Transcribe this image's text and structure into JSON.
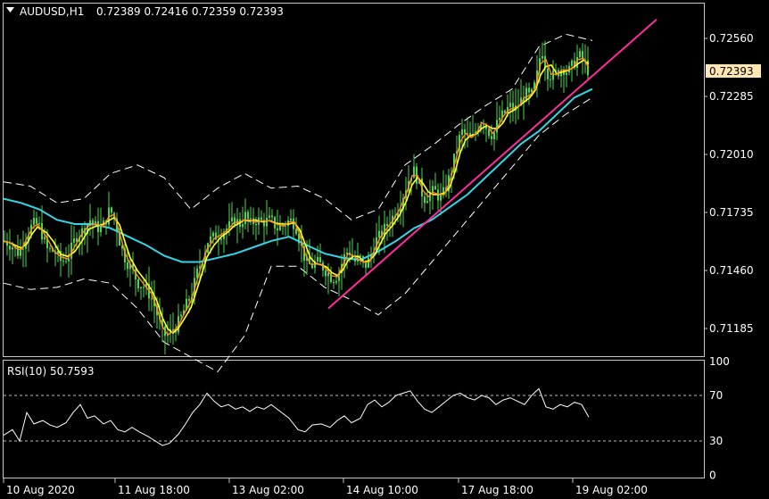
{
  "symbol_line": {
    "symbol": "AUDUSD,H1",
    "ohlc": "0.72389 0.72416 0.72359 0.72393"
  },
  "rsi_label": "RSI(10) 50.7593",
  "current_price": "0.72393",
  "colors": {
    "background": "#000000",
    "frame": "#c8c8c8",
    "candle": "#4cd64c",
    "ma_fast": "#ff8c1a",
    "ma_slow": "#ffff33",
    "ma_long": "#33d6e6",
    "bands": "#ffffff",
    "trendline": "#ff2d9b",
    "price_tag_bg": "#ffe6b3",
    "rsi_line": "#ffffff"
  },
  "chart_data": [
    {
      "type": "candlestick",
      "title": "AUDUSD,H1",
      "y_ticks": [
        0.7256,
        0.72285,
        0.7201,
        0.71735,
        0.7146,
        0.71185
      ],
      "y_tick_labels": [
        "0.72560",
        "0.72285",
        "0.72010",
        "0.71735",
        "0.71460",
        "0.71185"
      ],
      "ylim": [
        0.7099,
        0.7266
      ],
      "x_tick_labels": [
        "10 Aug 2020",
        "11 Aug 18:00",
        "13 Aug 02:00",
        "14 Aug 10:00",
        "17 Aug 18:00",
        "19 Aug 02:00"
      ],
      "close_path": [
        [
          0,
          0.716
        ],
        [
          8,
          0.7158
        ],
        [
          16,
          0.7154
        ],
        [
          20,
          0.7158
        ],
        [
          26,
          0.7164
        ],
        [
          32,
          0.7168
        ],
        [
          38,
          0.7168
        ],
        [
          48,
          0.7156
        ],
        [
          56,
          0.7155
        ],
        [
          64,
          0.715
        ],
        [
          72,
          0.7153
        ],
        [
          80,
          0.7162
        ],
        [
          88,
          0.7165
        ],
        [
          96,
          0.717
        ],
        [
          104,
          0.7166
        ],
        [
          112,
          0.7168
        ],
        [
          118,
          0.7175
        ],
        [
          124,
          0.717
        ],
        [
          130,
          0.7158
        ],
        [
          136,
          0.7151
        ],
        [
          142,
          0.7147
        ],
        [
          150,
          0.714
        ],
        [
          158,
          0.7138
        ],
        [
          166,
          0.7132
        ],
        [
          172,
          0.7124
        ],
        [
          178,
          0.7115
        ],
        [
          184,
          0.7116
        ],
        [
          190,
          0.7118
        ],
        [
          196,
          0.7122
        ],
        [
          202,
          0.7128
        ],
        [
          210,
          0.7135
        ],
        [
          216,
          0.7145
        ],
        [
          222,
          0.7152
        ],
        [
          228,
          0.716
        ],
        [
          236,
          0.7162
        ],
        [
          244,
          0.7164
        ],
        [
          252,
          0.7167
        ],
        [
          258,
          0.717
        ],
        [
          264,
          0.7168
        ],
        [
          270,
          0.7172
        ],
        [
          276,
          0.7168
        ],
        [
          282,
          0.717
        ],
        [
          290,
          0.7169
        ],
        [
          298,
          0.717
        ],
        [
          306,
          0.7166
        ],
        [
          314,
          0.7168
        ],
        [
          320,
          0.717
        ],
        [
          326,
          0.7168
        ],
        [
          332,
          0.7158
        ],
        [
          338,
          0.715
        ],
        [
          344,
          0.7148
        ],
        [
          350,
          0.715
        ],
        [
          356,
          0.7148
        ],
        [
          362,
          0.7145
        ],
        [
          368,
          0.7142
        ],
        [
          374,
          0.7144
        ],
        [
          380,
          0.7152
        ],
        [
          386,
          0.7156
        ],
        [
          392,
          0.715
        ],
        [
          398,
          0.7152
        ],
        [
          404,
          0.7148
        ],
        [
          410,
          0.7152
        ],
        [
          416,
          0.716
        ],
        [
          422,
          0.7163
        ],
        [
          428,
          0.7167
        ],
        [
          436,
          0.7172
        ],
        [
          444,
          0.7178
        ],
        [
          452,
          0.7188
        ],
        [
          458,
          0.7194
        ],
        [
          464,
          0.7188
        ],
        [
          470,
          0.718
        ],
        [
          476,
          0.7182
        ],
        [
          482,
          0.7184
        ],
        [
          488,
          0.718
        ],
        [
          494,
          0.7184
        ],
        [
          500,
          0.7192
        ],
        [
          506,
          0.7202
        ],
        [
          512,
          0.7212
        ],
        [
          518,
          0.721
        ],
        [
          524,
          0.7208
        ],
        [
          530,
          0.7214
        ],
        [
          536,
          0.7218
        ],
        [
          542,
          0.7212
        ],
        [
          548,
          0.721
        ],
        [
          554,
          0.7218
        ],
        [
          560,
          0.722
        ],
        [
          566,
          0.7224
        ],
        [
          572,
          0.7222
        ],
        [
          578,
          0.7226
        ],
        [
          584,
          0.723
        ],
        [
          590,
          0.7228
        ],
        [
          596,
          0.7236
        ],
        [
          602,
          0.7252
        ],
        [
          608,
          0.724
        ],
        [
          614,
          0.7238
        ],
        [
          620,
          0.724
        ],
        [
          626,
          0.7242
        ],
        [
          632,
          0.724
        ],
        [
          638,
          0.7244
        ],
        [
          644,
          0.7248
        ],
        [
          650,
          0.7245
        ],
        [
          656,
          0.7239
        ]
      ],
      "ma_long_path": [
        [
          0,
          0.718
        ],
        [
          20,
          0.7178
        ],
        [
          40,
          0.7175
        ],
        [
          60,
          0.717
        ],
        [
          80,
          0.7168
        ],
        [
          100,
          0.7168
        ],
        [
          120,
          0.7166
        ],
        [
          140,
          0.7162
        ],
        [
          160,
          0.7158
        ],
        [
          180,
          0.7153
        ],
        [
          200,
          0.715
        ],
        [
          220,
          0.715
        ],
        [
          240,
          0.7152
        ],
        [
          260,
          0.7154
        ],
        [
          280,
          0.7157
        ],
        [
          300,
          0.716
        ],
        [
          320,
          0.7162
        ],
        [
          340,
          0.7158
        ],
        [
          360,
          0.7154
        ],
        [
          380,
          0.7152
        ],
        [
          400,
          0.7151
        ],
        [
          420,
          0.7155
        ],
        [
          440,
          0.716
        ],
        [
          460,
          0.7166
        ],
        [
          480,
          0.717
        ],
        [
          500,
          0.7176
        ],
        [
          520,
          0.7182
        ],
        [
          540,
          0.719
        ],
        [
          560,
          0.7198
        ],
        [
          580,
          0.7206
        ],
        [
          600,
          0.7212
        ],
        [
          620,
          0.722
        ],
        [
          640,
          0.7228
        ],
        [
          660,
          0.7232
        ]
      ],
      "band_upper_path": [
        [
          0,
          0.7188
        ],
        [
          30,
          0.7186
        ],
        [
          60,
          0.7178
        ],
        [
          90,
          0.718
        ],
        [
          120,
          0.7192
        ],
        [
          150,
          0.7196
        ],
        [
          180,
          0.719
        ],
        [
          210,
          0.7175
        ],
        [
          240,
          0.7185
        ],
        [
          270,
          0.7192
        ],
        [
          300,
          0.7185
        ],
        [
          330,
          0.7186
        ],
        [
          360,
          0.718
        ],
        [
          390,
          0.717
        ],
        [
          420,
          0.7175
        ],
        [
          450,
          0.7196
        ],
        [
          480,
          0.7205
        ],
        [
          510,
          0.7215
        ],
        [
          540,
          0.7224
        ],
        [
          570,
          0.7232
        ],
        [
          600,
          0.7252
        ],
        [
          630,
          0.7258
        ],
        [
          660,
          0.7255
        ]
      ],
      "band_lower_path": [
        [
          0,
          0.714
        ],
        [
          30,
          0.7137
        ],
        [
          60,
          0.7138
        ],
        [
          90,
          0.7142
        ],
        [
          120,
          0.714
        ],
        [
          150,
          0.7128
        ],
        [
          180,
          0.7112
        ],
        [
          210,
          0.7105
        ],
        [
          240,
          0.7098
        ],
        [
          270,
          0.7115
        ],
        [
          300,
          0.7148
        ],
        [
          330,
          0.7148
        ],
        [
          360,
          0.7138
        ],
        [
          390,
          0.7132
        ],
        [
          420,
          0.7125
        ],
        [
          450,
          0.7135
        ],
        [
          480,
          0.715
        ],
        [
          510,
          0.7165
        ],
        [
          540,
          0.718
        ],
        [
          570,
          0.7195
        ],
        [
          600,
          0.721
        ],
        [
          630,
          0.722
        ],
        [
          660,
          0.7228
        ]
      ],
      "trendline": [
        [
          368,
          0.7128
        ],
        [
          736,
          0.7265
        ]
      ]
    },
    {
      "type": "line",
      "title": "RSI(10) 50.7593",
      "y_ticks": [
        100,
        70,
        30,
        0
      ],
      "y_tick_labels": [
        "100",
        "70",
        "30",
        "0"
      ],
      "ylim": [
        0,
        100
      ],
      "levels": [
        70,
        30
      ],
      "series": [
        {
          "values_path": [
            [
              0,
              35
            ],
            [
              10,
              40
            ],
            [
              18,
              30
            ],
            [
              26,
              55
            ],
            [
              34,
              45
            ],
            [
              44,
              48
            ],
            [
              52,
              44
            ],
            [
              60,
              42
            ],
            [
              70,
              46
            ],
            [
              78,
              55
            ],
            [
              86,
              62
            ],
            [
              94,
              50
            ],
            [
              102,
              52
            ],
            [
              112,
              45
            ],
            [
              120,
              48
            ],
            [
              128,
              40
            ],
            [
              136,
              38
            ],
            [
              144,
              42
            ],
            [
              152,
              38
            ],
            [
              162,
              34
            ],
            [
              170,
              30
            ],
            [
              178,
              26
            ],
            [
              186,
              28
            ],
            [
              196,
              36
            ],
            [
              204,
              45
            ],
            [
              212,
              55
            ],
            [
              220,
              62
            ],
            [
              228,
              72
            ],
            [
              236,
              65
            ],
            [
              244,
              60
            ],
            [
              252,
              62
            ],
            [
              260,
              58
            ],
            [
              268,
              60
            ],
            [
              276,
              56
            ],
            [
              284,
              60
            ],
            [
              292,
              58
            ],
            [
              300,
              62
            ],
            [
              310,
              56
            ],
            [
              320,
              50
            ],
            [
              330,
              40
            ],
            [
              338,
              38
            ],
            [
              346,
              44
            ],
            [
              356,
              45
            ],
            [
              366,
              42
            ],
            [
              374,
              48
            ],
            [
              382,
              52
            ],
            [
              390,
              46
            ],
            [
              400,
              50
            ],
            [
              408,
              62
            ],
            [
              416,
              66
            ],
            [
              424,
              60
            ],
            [
              432,
              64
            ],
            [
              440,
              70
            ],
            [
              448,
              72
            ],
            [
              456,
              74
            ],
            [
              464,
              65
            ],
            [
              472,
              58
            ],
            [
              480,
              55
            ],
            [
              488,
              60
            ],
            [
              496,
              65
            ],
            [
              504,
              70
            ],
            [
              512,
              72
            ],
            [
              520,
              68
            ],
            [
              528,
              66
            ],
            [
              536,
              70
            ],
            [
              544,
              68
            ],
            [
              552,
              62
            ],
            [
              560,
              66
            ],
            [
              568,
              68
            ],
            [
              576,
              65
            ],
            [
              584,
              62
            ],
            [
              592,
              70
            ],
            [
              600,
              76
            ],
            [
              608,
              60
            ],
            [
              616,
              58
            ],
            [
              624,
              62
            ],
            [
              632,
              60
            ],
            [
              640,
              64
            ],
            [
              648,
              62
            ],
            [
              656,
              51
            ]
          ]
        }
      ]
    }
  ]
}
